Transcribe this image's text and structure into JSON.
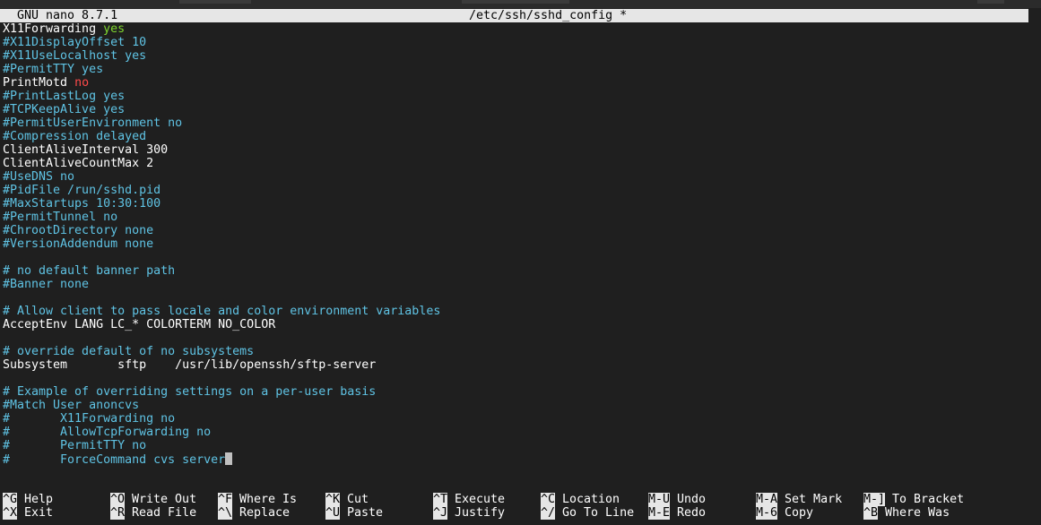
{
  "title_bar": {
    "app_version": "GNU nano 8.7.1",
    "file_path": "/etc/ssh/sshd_config *"
  },
  "editor_lines": [
    [
      {
        "t": "X11Forwarding ",
        "c": "w"
      },
      {
        "t": "yes",
        "c": "y"
      }
    ],
    [
      {
        "t": "#X11DisplayOffset 10",
        "c": "c"
      }
    ],
    [
      {
        "t": "#X11UseLocalhost yes",
        "c": "c"
      }
    ],
    [
      {
        "t": "#PermitTTY yes",
        "c": "c"
      }
    ],
    [
      {
        "t": "PrintMotd ",
        "c": "w"
      },
      {
        "t": "no",
        "c": "r"
      }
    ],
    [
      {
        "t": "#PrintLastLog yes",
        "c": "c"
      }
    ],
    [
      {
        "t": "#TCPKeepAlive yes",
        "c": "c"
      }
    ],
    [
      {
        "t": "#PermitUserEnvironment no",
        "c": "c"
      }
    ],
    [
      {
        "t": "#Compression delayed",
        "c": "c"
      }
    ],
    [
      {
        "t": "ClientAliveInterval 300",
        "c": "w"
      }
    ],
    [
      {
        "t": "ClientAliveCountMax 2",
        "c": "w"
      }
    ],
    [
      {
        "t": "#UseDNS no",
        "c": "c"
      }
    ],
    [
      {
        "t": "#PidFile /run/sshd.pid",
        "c": "c"
      }
    ],
    [
      {
        "t": "#MaxStartups 10:30:100",
        "c": "c"
      }
    ],
    [
      {
        "t": "#PermitTunnel no",
        "c": "c"
      }
    ],
    [
      {
        "t": "#ChrootDirectory none",
        "c": "c"
      }
    ],
    [
      {
        "t": "#VersionAddendum none",
        "c": "c"
      }
    ],
    [],
    [
      {
        "t": "# no default banner path",
        "c": "c"
      }
    ],
    [
      {
        "t": "#Banner none",
        "c": "c"
      }
    ],
    [],
    [
      {
        "t": "# Allow client to pass locale and color environment variables",
        "c": "c"
      }
    ],
    [
      {
        "t": "AcceptEnv LANG LC_* COLORTERM NO_COLOR",
        "c": "w"
      }
    ],
    [],
    [
      {
        "t": "# override default of no subsystems",
        "c": "c"
      }
    ],
    [
      {
        "t": "Subsystem       sftp    /usr/lib/openssh/sftp-server",
        "c": "w"
      }
    ],
    [],
    [
      {
        "t": "# Example of overriding settings on a per-user basis",
        "c": "c"
      }
    ],
    [
      {
        "t": "#Match User anoncvs",
        "c": "c"
      }
    ],
    [
      {
        "t": "#       X11Forwarding no",
        "c": "c"
      }
    ],
    [
      {
        "t": "#       AllowTcpForwarding no",
        "c": "c"
      }
    ],
    [
      {
        "t": "#       PermitTTY no",
        "c": "c"
      }
    ],
    [
      {
        "t": "#       ForceCommand cvs server",
        "c": "c"
      }
    ]
  ],
  "shortcuts": [
    [
      {
        "key": "^G",
        "label": "Help"
      },
      {
        "key": "^X",
        "label": "Exit"
      }
    ],
    [
      {
        "key": "^O",
        "label": "Write Out"
      },
      {
        "key": "^R",
        "label": "Read File"
      }
    ],
    [
      {
        "key": "^F",
        "label": "Where Is"
      },
      {
        "key": "^\\",
        "label": "Replace"
      }
    ],
    [
      {
        "key": "^K",
        "label": "Cut"
      },
      {
        "key": "^U",
        "label": "Paste"
      }
    ],
    [
      {
        "key": "^T",
        "label": "Execute"
      },
      {
        "key": "^J",
        "label": "Justify"
      }
    ],
    [
      {
        "key": "^C",
        "label": "Location"
      },
      {
        "key": "^/",
        "label": "Go To Line"
      }
    ],
    [
      {
        "key": "M-U",
        "label": "Undo"
      },
      {
        "key": "M-E",
        "label": "Redo"
      }
    ],
    [
      {
        "key": "M-A",
        "label": "Set Mark"
      },
      {
        "key": "M-6",
        "label": "Copy"
      }
    ],
    [
      {
        "key": "M-]",
        "label": "To Bracket"
      },
      {
        "key": "^B",
        "label": "Where Was"
      }
    ]
  ],
  "colors": {
    "background": "#1f1f1f",
    "comment": "#5fc3e4",
    "value_yes": "#7fd62e",
    "value_no": "#ff4a4a",
    "titlebar_bg": "#e6e6e6"
  }
}
